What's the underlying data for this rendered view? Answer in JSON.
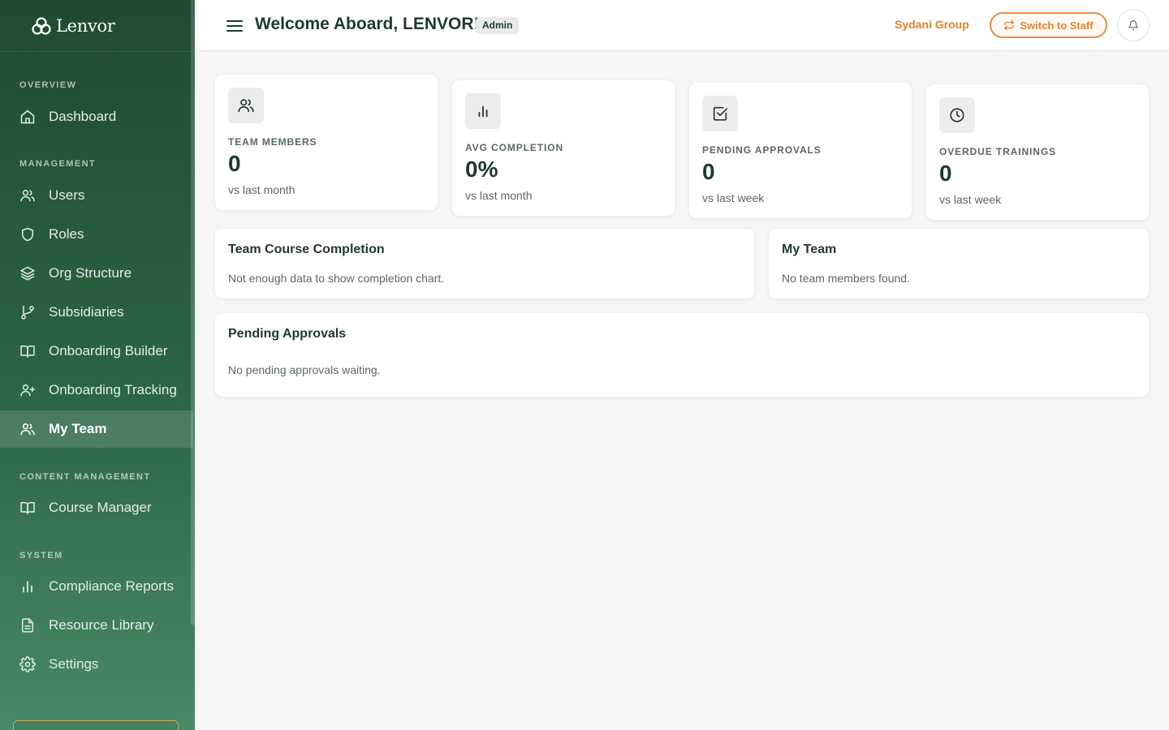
{
  "brand": {
    "name": "Lenvor",
    "logo_icon": "lenvor-logo-icon"
  },
  "sidebar": {
    "sections": {
      "overview": "OVERVIEW",
      "management": "MANAGEMENT",
      "content": "CONTENT MANAGEMENT",
      "system": "SYSTEM"
    },
    "items": [
      {
        "label": "Dashboard",
        "icon": "home-icon"
      },
      {
        "label": "Users",
        "icon": "users-icon"
      },
      {
        "label": "Roles",
        "icon": "shield-icon"
      },
      {
        "label": "Org Structure",
        "icon": "layers-icon"
      },
      {
        "label": "Subsidiaries",
        "icon": "git-branch-icon"
      },
      {
        "label": "Onboarding Builder",
        "icon": "book-open-icon"
      },
      {
        "label": "Onboarding Tracking",
        "icon": "user-plus-icon"
      },
      {
        "label": "My Team",
        "icon": "users-icon",
        "active": true
      },
      {
        "label": "Course Manager",
        "icon": "book-open-icon"
      },
      {
        "label": "Compliance Reports",
        "icon": "bar-chart-icon"
      },
      {
        "label": "Resource Library",
        "icon": "file-text-icon"
      },
      {
        "label": "Settings",
        "icon": "gear-icon"
      }
    ]
  },
  "header": {
    "title": "Welcome Aboard, LENVOR!",
    "role_badge": "Admin",
    "org_name": "Sydani Group",
    "switch_label": "Switch to Staff"
  },
  "stats": [
    {
      "label": "TEAM MEMBERS",
      "value": "0",
      "sub": "vs last month",
      "icon": "users-icon"
    },
    {
      "label": "AVG COMPLETION",
      "value": "0%",
      "sub": "vs last month",
      "icon": "bar-chart-icon"
    },
    {
      "label": "PENDING APPROVALS",
      "value": "0",
      "sub": "vs last week",
      "icon": "check-square-icon"
    },
    {
      "label": "OVERDUE TRAININGS",
      "value": "0",
      "sub": "vs last week",
      "icon": "clock-icon"
    }
  ],
  "panels": {
    "completion": {
      "title": "Team Course Completion",
      "text": "Not enough data to show completion chart."
    },
    "my_team": {
      "title": "My Team",
      "text": "No team members found."
    },
    "approvals": {
      "title": "Pending Approvals",
      "text": "No pending approvals waiting."
    }
  },
  "colors": {
    "sidebar_top": "#1f4a31",
    "sidebar_bottom": "#4a8a66",
    "accent_orange": "#e0852e",
    "text_dark": "#1e3a2c"
  }
}
